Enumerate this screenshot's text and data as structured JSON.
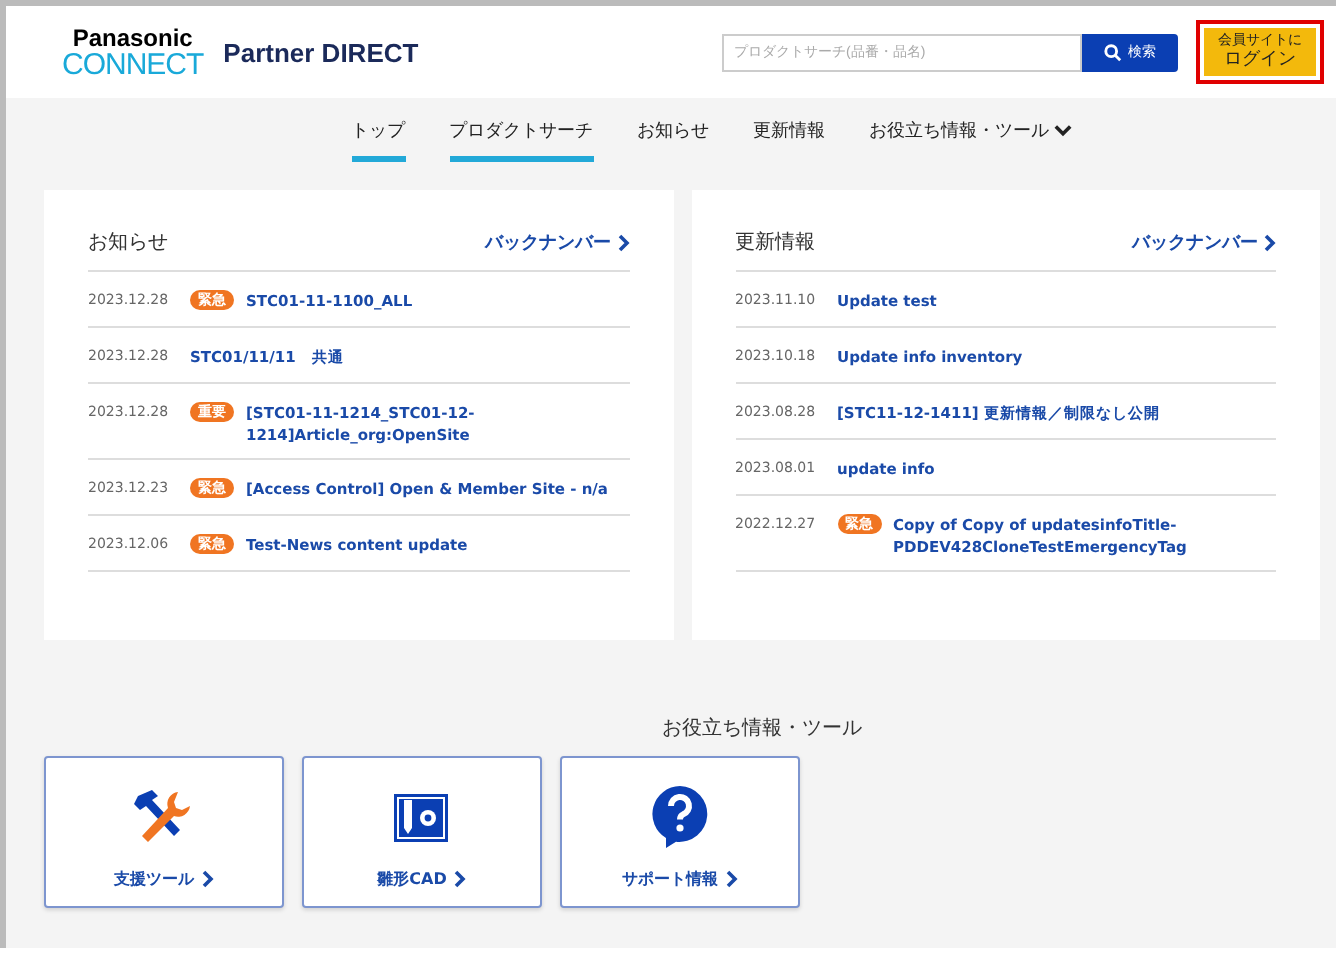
{
  "header": {
    "logo_top": "Panasonic",
    "logo_bottom": "CONNECT",
    "site_name": "Partner DIRECT",
    "search": {
      "placeholder": "プロダクトサーチ(品番・品名)",
      "button": "検索"
    },
    "login": {
      "line1": "会員サイトに",
      "line2": "ログイン"
    }
  },
  "nav": [
    {
      "label": "トップ",
      "selected": true,
      "kind": "link"
    },
    {
      "label": "プロダクトサーチ",
      "selected": true,
      "kind": "link"
    },
    {
      "label": "お知らせ",
      "selected": false,
      "kind": "link"
    },
    {
      "label": "更新情報",
      "selected": false,
      "kind": "link"
    },
    {
      "label": "お役立ち情報・ツール",
      "selected": false,
      "kind": "dropdown"
    }
  ],
  "panels": [
    {
      "title": "お知らせ",
      "more": "バックナンバー",
      "items": [
        {
          "date": "2023.12.28",
          "badge": "緊急",
          "title": "STC01-11-1100_ALL"
        },
        {
          "date": "2023.12.28",
          "title": "STC01/11/11　共通"
        },
        {
          "date": "2023.12.28",
          "badge": "重要",
          "title": "[STC01-11-1214_STC01-12-1214]Article_org:OpenSite"
        },
        {
          "date": "2023.12.23",
          "badge": "緊急",
          "title": "[Access Control] Open & Member Site - n/a"
        },
        {
          "date": "2023.12.06",
          "badge": "緊急",
          "title": "Test-News content update"
        }
      ]
    },
    {
      "title": "更新情報",
      "more": "バックナンバー",
      "items": [
        {
          "date": "2023.11.10",
          "title": "Update test"
        },
        {
          "date": "2023.10.18",
          "title": "Update info inventory"
        },
        {
          "date": "2023.08.28",
          "title": "[STC11-12-1411] 更新情報／制限なし公開"
        },
        {
          "date": "2023.08.01",
          "title": "update info"
        },
        {
          "date": "2022.12.27",
          "badge": "緊急",
          "title": "Copy of Copy of updatesinfoTitle-PDDEV428CloneTestEmergencyTag"
        }
      ]
    }
  ],
  "tools": {
    "title": "お役立ち情報・ツール",
    "cards": [
      {
        "label": "支援ツール",
        "kind": "tools"
      },
      {
        "label": "雛形CAD",
        "kind": "cad"
      },
      {
        "label": "サポート情報",
        "kind": "help"
      }
    ]
  }
}
